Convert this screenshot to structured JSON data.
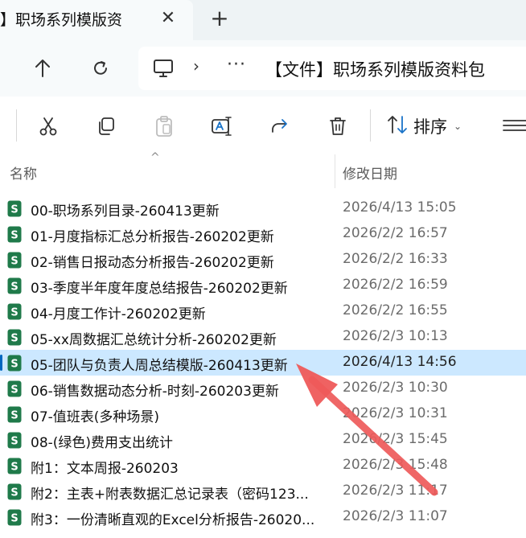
{
  "tab": {
    "title": "】职场系列模版资",
    "close_glyph": "✕",
    "new_tab_glyph": "+"
  },
  "nav": {
    "up_icon": "arrow-up-icon",
    "refresh_icon": "refresh-icon",
    "separator": "›",
    "ellipsis": "···",
    "path": "【文件】职场系列模版资料包"
  },
  "toolbar": {
    "sort_label": "排序",
    "sort_caret": "⌄"
  },
  "columns": {
    "name": "名称",
    "date": "修改日期",
    "sort_arrow": "^"
  },
  "files": [
    {
      "name": "00-职场系列目录-260413更新",
      "date": "2026/4/13 15:05"
    },
    {
      "name": "01-月度指标汇总分析报告-260202更新",
      "date": "2026/2/2 16:57"
    },
    {
      "name": "02-销售日报动态分析报告-260202更新",
      "date": "2026/2/2 16:33"
    },
    {
      "name": "03-季度半年度年度总结报告-260202更新",
      "date": "2026/2/2 16:59"
    },
    {
      "name": "04-月度工作计-260202更新",
      "date": "2026/2/2 16:55"
    },
    {
      "name": "05-xx周数据汇总统计分析-260202更新",
      "date": "2026/2/3 10:13"
    },
    {
      "name": "05-团队与负责人周总结模版-260413更新",
      "date": "2026/4/13 14:56",
      "selected": true
    },
    {
      "name": "06-销售数据动态分析-时刻-260203更新",
      "date": "2026/2/3 10:30"
    },
    {
      "name": "07-值班表(多种场景)",
      "date": "2026/2/3 10:31"
    },
    {
      "name": "08-(绿色)费用支出统计",
      "date": "2026/2/3 15:45"
    },
    {
      "name": "附1：文本周报-260203",
      "date": "2026/2/3 15:48"
    },
    {
      "name": "附2：主表+附表数据汇总记录表（密码123...",
      "date": "2026/2/3 11:17"
    },
    {
      "name": "附3：一份清晰直观的Excel分析报告-26020...",
      "date": "2026/2/3 11:07"
    }
  ],
  "colors": {
    "accent": "#0067c0",
    "selection": "#cce8ff",
    "excel_green": "#1f7a4a",
    "annotation_arrow": "#ee5a5a"
  }
}
